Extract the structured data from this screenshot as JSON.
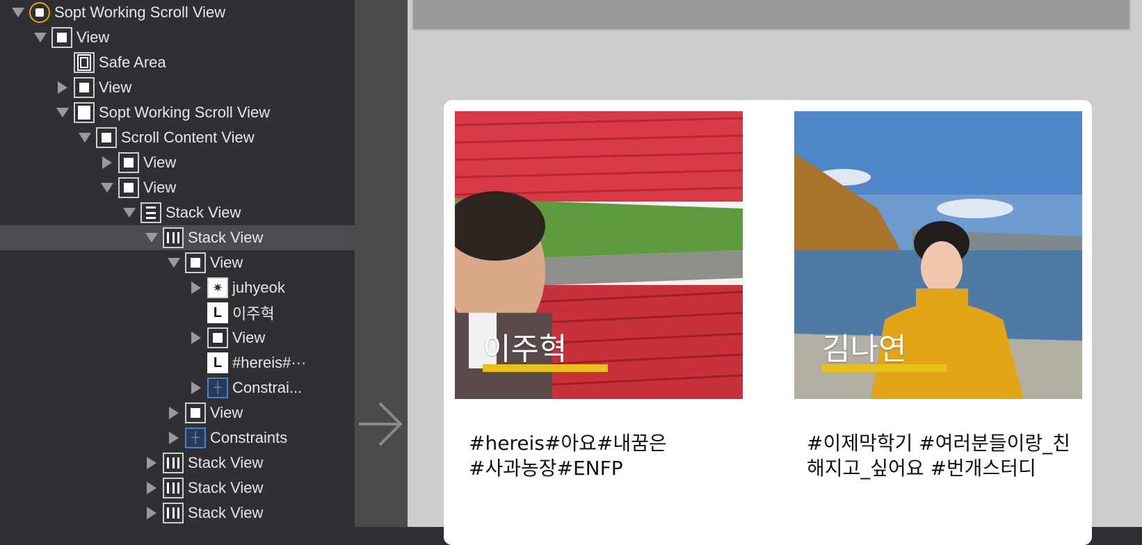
{
  "outline": {
    "rows": [
      {
        "label": "Sopt Working Scroll View"
      },
      {
        "label": "View"
      },
      {
        "label": "Safe Area"
      },
      {
        "label": "View"
      },
      {
        "label": "Sopt Working Scroll View"
      },
      {
        "label": "Scroll Content View"
      },
      {
        "label": "View"
      },
      {
        "label": "View"
      },
      {
        "label": "Stack View"
      },
      {
        "label": "Stack View"
      },
      {
        "label": "View"
      },
      {
        "label": "juhyeok"
      },
      {
        "label": "이주혁"
      },
      {
        "label": "View"
      },
      {
        "label": "#hereis#···"
      },
      {
        "label": "Constrai..."
      },
      {
        "label": "View"
      },
      {
        "label": "Constraints"
      },
      {
        "label": "Stack View"
      },
      {
        "label": "Stack View"
      },
      {
        "label": "Stack View"
      }
    ]
  },
  "canvas": {
    "profiles": [
      {
        "name": "이주혁",
        "tags_line1": "#hereis#아요#내꿈은",
        "tags_line2": "#사과농장#ENFP"
      },
      {
        "name": "김나연",
        "tags_line1": "#이제막학기 #여러분들이랑_친",
        "tags_line2": "해지고_싶어요 #번개스터디"
      }
    ]
  },
  "colors": {
    "accent_underline": "#e8c01a",
    "selection": "#4b4c4f",
    "root_ring": "#e5a21a"
  }
}
